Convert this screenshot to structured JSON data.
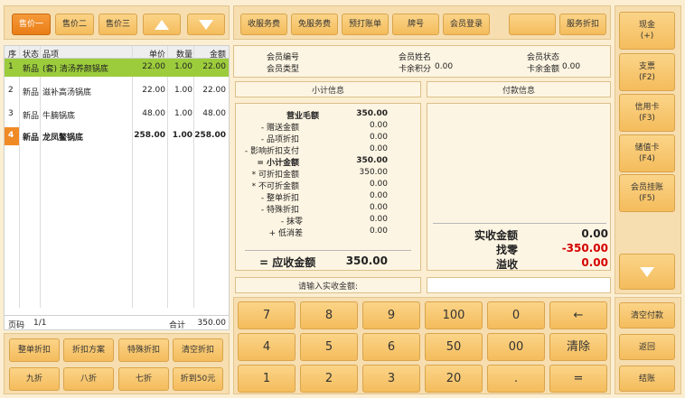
{
  "price_tabs": [
    "售价一",
    "售价二",
    "售价三"
  ],
  "top_actions": [
    "收服务费",
    "免服务费",
    "预打账单",
    "牌号",
    "会员登录",
    "",
    "服务折扣"
  ],
  "payment_methods": [
    "现金\n(+)",
    "支票\n(F2)",
    "信用卡\n(F3)",
    "储值卡\n(F4)",
    "会员挂账\n(F5)"
  ],
  "order": {
    "headers": {
      "seq": "序",
      "status": "状态",
      "item": "品项",
      "price": "单价",
      "qty": "数量",
      "amount": "金额"
    },
    "rows": [
      {
        "seq": "1",
        "status": "新品",
        "item": "(套) 清汤养颜锅底",
        "price": "22.00",
        "qty": "1.00",
        "amount": "22.00"
      },
      {
        "seq": "2",
        "status": "新品",
        "item": "滋补高汤锅底",
        "price": "22.00",
        "qty": "1.00",
        "amount": "22.00"
      },
      {
        "seq": "3",
        "status": "新品",
        "item": "牛腩锅底",
        "price": "48.00",
        "qty": "1.00",
        "amount": "48.00"
      },
      {
        "seq": "4",
        "status": "新品",
        "item": "龙凤鳖锅底",
        "price": "258.00",
        "qty": "1.00",
        "amount": "258.00"
      }
    ],
    "footer_page_label": "页码",
    "footer_page": "1/1",
    "footer_total_label": "合计",
    "footer_total": "350.00"
  },
  "discount_buttons": [
    "整单折扣",
    "折扣方案",
    "特殊折扣",
    "清空折扣",
    "九折",
    "八折",
    "七折",
    "折到50元"
  ],
  "member": {
    "id_label": "会员编号",
    "type_label": "会员类型",
    "name_label": "会员姓名",
    "points_label": "卡余积分",
    "points": "0.00",
    "status_label": "会员状态",
    "balance_label": "卡余金额",
    "balance": "0.00"
  },
  "subtotal_title": "小计信息",
  "payment_title": "付款信息",
  "subtotal_rows": [
    {
      "label": "营业毛额",
      "value": "350.00",
      "bold": true
    },
    {
      "label": "- 赠送金额",
      "value": "0.00"
    },
    {
      "label": "- 品项折扣",
      "value": "0.00"
    },
    {
      "label": "- 影响折扣支付",
      "value": "0.00"
    },
    {
      "label": "= 小计金额",
      "value": "350.00",
      "bold": true
    },
    {
      "label": "* 可折扣金额",
      "value": "350.00"
    },
    {
      "label": "* 不可折金额",
      "value": "0.00"
    },
    {
      "label": "- 整单折扣",
      "value": "0.00"
    },
    {
      "label": "- 特殊折扣",
      "value": "0.00"
    },
    {
      "label": "- 抹零",
      "value": "0.00"
    },
    {
      "label": "+ 低消差",
      "value": "0.00"
    }
  ],
  "receivable_label": "= 应收金额",
  "receivable_value": "350.00",
  "paid_label": "实收金额",
  "paid_value": "0.00",
  "change_label": "找零",
  "change_value": "-350.00",
  "overpay_label": "溢收",
  "overpay_value": "0.00",
  "input_prompt": "请输入实收金额:",
  "keypad": [
    "7",
    "8",
    "9",
    "100",
    "0",
    "←",
    "4",
    "5",
    "6",
    "50",
    "00",
    "清除",
    "1",
    "2",
    "3",
    "20",
    ".",
    "="
  ],
  "side_actions": [
    "清空付款",
    "返回",
    "结账"
  ],
  "colors": {
    "accent": "#ea7d16",
    "highlight_row": "#9ccc3c",
    "selected_seq": "#f08a24",
    "negative": "#d40000"
  }
}
